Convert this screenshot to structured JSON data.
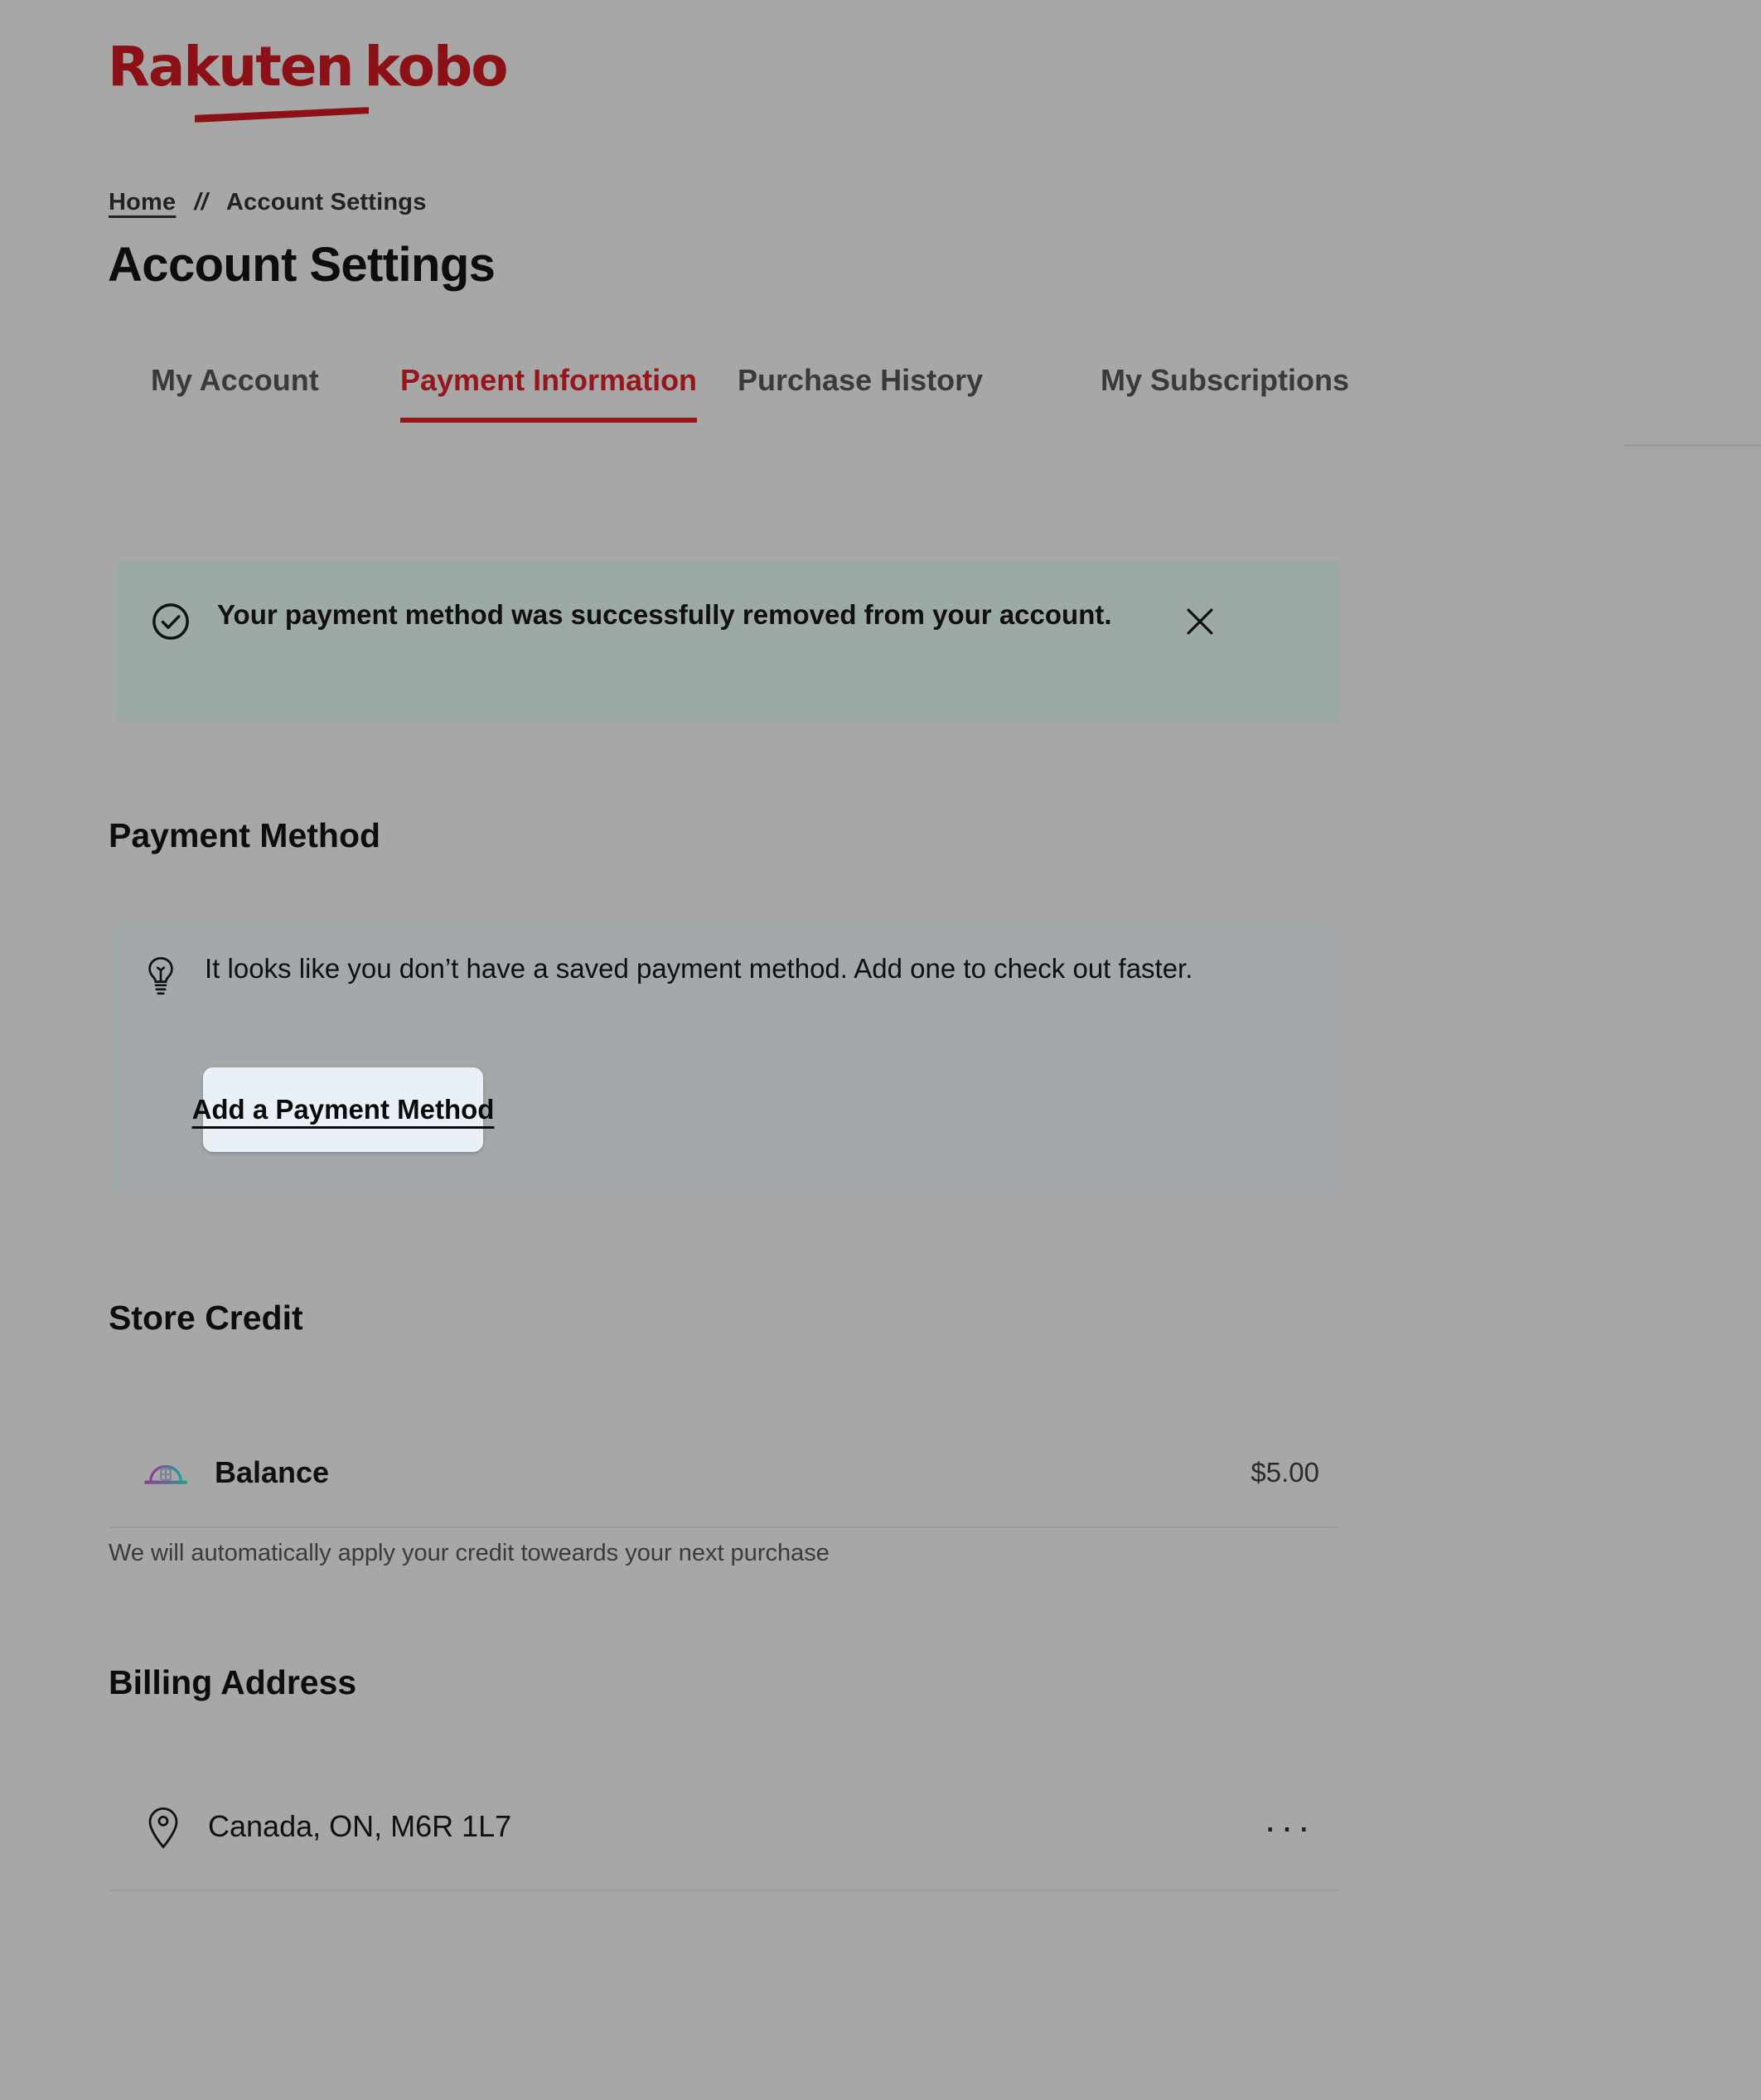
{
  "brand": {
    "logo_first": "Rakuten",
    "logo_second": "kobo",
    "logo_color": "#8c1117"
  },
  "breadcrumb": {
    "home": "Home",
    "separator": "//",
    "current": "Account Settings"
  },
  "header": {
    "title": "Account Settings"
  },
  "tabs": {
    "active_index": 1,
    "items": [
      {
        "label": "My Account"
      },
      {
        "label": "Payment Information"
      },
      {
        "label": "Purchase History"
      },
      {
        "label": "My Subscriptions"
      }
    ],
    "active_color": "#96161b"
  },
  "alert": {
    "icon": "check-circle-icon",
    "message": "Your payment method was successfully removed from your account.",
    "close_icon": "close-icon",
    "background": "#9ca9a4"
  },
  "payment_method": {
    "heading": "Payment Method",
    "icon": "lightbulb-icon",
    "empty_text": "It looks like you don’t have a saved payment method. Add one to check out faster.",
    "add_button_label": "Add a Payment Method",
    "box_background": "#a3a8ab",
    "button_background": "#eaf0f7"
  },
  "store_credit": {
    "heading": "Store Credit",
    "icon": "piggy-bank-icon",
    "balance_label": "Balance",
    "balance_amount": "$5.00",
    "note": "We will automatically apply your credit toweards your next purchase"
  },
  "billing_address": {
    "heading": "Billing Address",
    "icon": "map-pin-icon",
    "address": "Canada, ON, M6R 1L7",
    "menu_icon": "ellipsis-icon",
    "menu_label": "···"
  }
}
